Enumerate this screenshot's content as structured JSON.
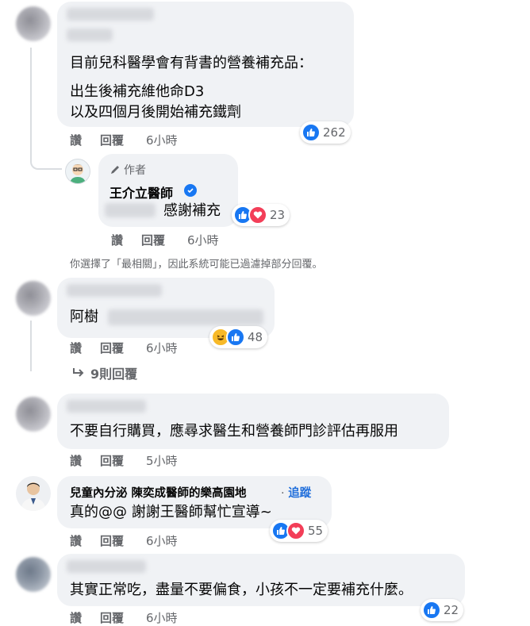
{
  "comments": [
    {
      "text_lines": [
        "目前兒科醫學會有背書的營養補充品：",
        "出生後補充維他命D3",
        "以及四個月後開始補充鐵劑"
      ],
      "reaction_count": "262",
      "actions": {
        "like": "讚",
        "reply": "回覆",
        "time": "6小時"
      }
    },
    {
      "author_badge": "作者",
      "author_name": "王介立醫師",
      "text": "感謝補充",
      "reaction_count": "23",
      "actions": {
        "like": "讚",
        "reply": "回覆",
        "time": "6小時"
      }
    },
    {
      "text": "阿樹",
      "reaction_count": "48",
      "actions": {
        "like": "讚",
        "reply": "回覆",
        "time": "6小時"
      },
      "more_replies": "9則回覆"
    },
    {
      "text": "不要自行購買，應尋求醫生和營養師門診評估再服用",
      "actions": {
        "like": "讚",
        "reply": "回覆",
        "time": "5小時"
      }
    },
    {
      "author_name": "兒童內分泌  陳奕成醫師的樂高園地",
      "follow": "追蹤",
      "text": "真的@@ 謝謝王醫師幫忙宣導~",
      "reaction_count": "55",
      "actions": {
        "like": "讚",
        "reply": "回覆",
        "time": "6小時"
      }
    },
    {
      "text": "其實正常吃，盡量不要偏食，小孩不一定要補充什麼。",
      "reaction_count": "22",
      "actions": {
        "like": "讚",
        "reply": "回覆",
        "time": "6小時"
      }
    }
  ],
  "filter_note": "你選擇了「最相關」，因此系統可能已過濾掉部分回覆。",
  "colors": {
    "like": "#1877f2",
    "love": "#f33e58",
    "haha": "#f7b928",
    "meta": "#65676b",
    "bubble": "#f0f2f5",
    "follow": "#216fdb"
  }
}
